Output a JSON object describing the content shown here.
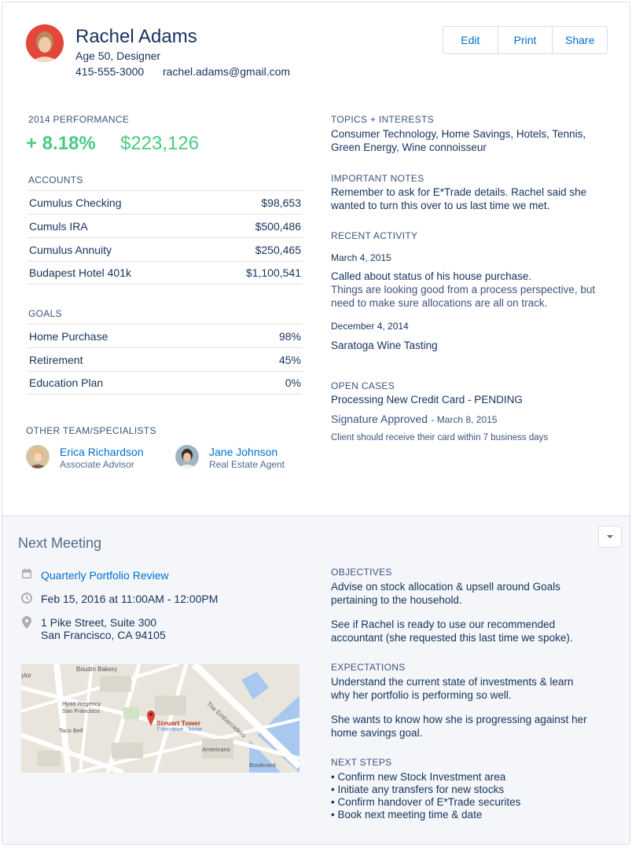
{
  "profile": {
    "name": "Rachel Adams",
    "age_title": "Age 50, Designer",
    "phone": "415-555-3000",
    "email": "rachel.adams@gmail.com"
  },
  "actions": {
    "edit": "Edit",
    "print": "Print",
    "share": "Share"
  },
  "performance": {
    "label": "2014 PERFORMANCE",
    "percent": "+ 8.18%",
    "amount": "$223,126"
  },
  "accounts": {
    "label": "ACCOUNTS",
    "items": [
      {
        "name": "Cumulus Checking",
        "value": "$98,653"
      },
      {
        "name": "Cumuls IRA",
        "value": "$500,486"
      },
      {
        "name": "Cumulus Annuity",
        "value": "$250,465"
      },
      {
        "name": "Budapest Hotel 401k",
        "value": "$1,100,541"
      }
    ]
  },
  "goals": {
    "label": "GOALS",
    "items": [
      {
        "name": "Home Purchase",
        "value": "98%"
      },
      {
        "name": "Retirement",
        "value": "45%"
      },
      {
        "name": "Education Plan",
        "value": "0%"
      }
    ]
  },
  "team": {
    "label": "OTHER TEAM/SPECIALISTS",
    "members": [
      {
        "name": "Erica Richardson",
        "role": "Associate Advisor"
      },
      {
        "name": "Jane Johnson",
        "role": "Real Estate Agent"
      }
    ]
  },
  "topics": {
    "label": "TOPICS + INTERESTS",
    "text": "Consumer Technology, Home Savings, Hotels, Tennis, Green Energy, Wine connoisseur"
  },
  "notes": {
    "label": "IMPORTANT NOTES",
    "text": "Remember to ask for E*Trade details. Rachel said she wanted to turn this over to us last time we met."
  },
  "activity": {
    "label": "RECENT ACTIVITY",
    "items": [
      {
        "date": "March 4, 2015",
        "title": "Called about status of his house purchase.",
        "detail": "Things are looking good from a process perspective, but need to make sure allocations are all on track."
      },
      {
        "date": "December 4, 2014",
        "title": "Saratoga Wine Tasting",
        "detail": ""
      }
    ]
  },
  "cases": {
    "label": "OPEN CASES",
    "title": "Processing New Credit Card - PENDING",
    "status": "Signature Approved",
    "status_date": "- March 8, 2015",
    "detail": "Client should receive their card within 7 business days"
  },
  "meeting": {
    "heading": "Next Meeting",
    "title": "Quarterly Portfolio Review",
    "datetime": "Feb 15, 2016 at 11:00AM - 12:00PM",
    "address1": "1 Pike Street, Suite 300",
    "address2": "San Francisco, CA 94105",
    "map": {
      "place": "Steuart Tower",
      "drive": "7 min drive · home",
      "labels": [
        "Boudin Bakery",
        "ylor",
        "Hyatt Regency",
        "San Francisco",
        "Taco Bell",
        "Americano",
        "Boulevard",
        "The Embarcadero"
      ]
    },
    "objectives": {
      "label": "OBJECTIVES",
      "p1": "Advise on stock allocation & upsell around Goals pertaining to the household.",
      "p2": "See if Rachel is ready to use our recommended accountant (she requested this last time we spoke)."
    },
    "expectations": {
      "label": "EXPECTATIONS",
      "p1": "Understand the current state of investments & learn why her portfolio is performing so well.",
      "p2": "She wants to know how she is progressing against her home savings goal."
    },
    "next_steps": {
      "label": "NEXT STEPS",
      "items": [
        "• Confirm new Stock Investment area",
        "• Initiate any transfers for new stocks",
        "• Confirm handover of E*Trade securites",
        "• Book next meeting time & date"
      ]
    }
  },
  "colors": {
    "accent": "#0070d2",
    "positive": "#4bca81",
    "text": "#16325c"
  }
}
